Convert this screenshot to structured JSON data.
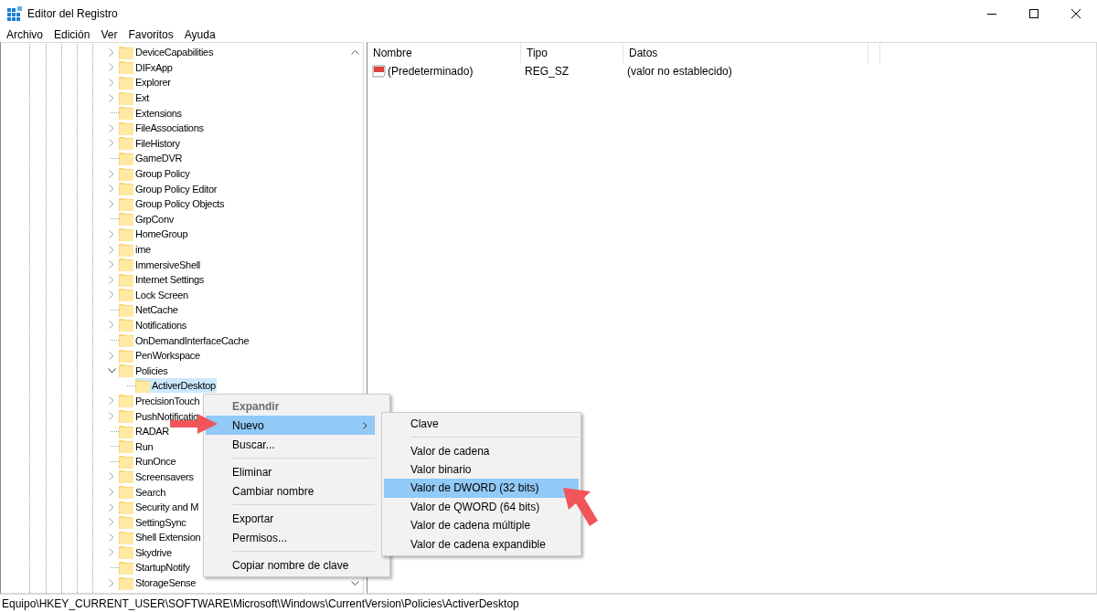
{
  "window": {
    "title": "Editor del Registro"
  },
  "menu_bar": [
    "Archivo",
    "Edición",
    "Ver",
    "Favoritos",
    "Ayuda"
  ],
  "tree": {
    "items": [
      {
        "label": "DeviceCapabilities",
        "has_children": true,
        "expanded": false,
        "selected": false
      },
      {
        "label": "DIFxApp",
        "has_children": true,
        "expanded": false,
        "selected": false
      },
      {
        "label": "Explorer",
        "has_children": true,
        "expanded": false,
        "selected": false
      },
      {
        "label": "Ext",
        "has_children": true,
        "expanded": false,
        "selected": false
      },
      {
        "label": "Extensions",
        "has_children": false,
        "selected": false
      },
      {
        "label": "FileAssociations",
        "has_children": true,
        "expanded": false,
        "selected": false
      },
      {
        "label": "FileHistory",
        "has_children": true,
        "expanded": false,
        "selected": false
      },
      {
        "label": "GameDVR",
        "has_children": false,
        "selected": false
      },
      {
        "label": "Group Policy",
        "has_children": true,
        "expanded": false,
        "selected": false
      },
      {
        "label": "Group Policy Editor",
        "has_children": true,
        "expanded": false,
        "selected": false
      },
      {
        "label": "Group Policy Objects",
        "has_children": true,
        "expanded": false,
        "selected": false
      },
      {
        "label": "GrpConv",
        "has_children": false,
        "selected": false
      },
      {
        "label": "HomeGroup",
        "has_children": true,
        "expanded": false,
        "selected": false
      },
      {
        "label": "ime",
        "has_children": true,
        "expanded": false,
        "selected": false
      },
      {
        "label": "ImmersiveShell",
        "has_children": true,
        "expanded": false,
        "selected": false
      },
      {
        "label": "Internet Settings",
        "has_children": true,
        "expanded": false,
        "selected": false
      },
      {
        "label": "Lock Screen",
        "has_children": true,
        "expanded": false,
        "selected": false
      },
      {
        "label": "NetCache",
        "has_children": false,
        "selected": false
      },
      {
        "label": "Notifications",
        "has_children": true,
        "expanded": false,
        "selected": false
      },
      {
        "label": "OnDemandInterfaceCache",
        "has_children": false,
        "selected": false
      },
      {
        "label": "PenWorkspace",
        "has_children": true,
        "expanded": false,
        "selected": false
      },
      {
        "label": "Policies",
        "has_children": true,
        "expanded": true,
        "selected": false,
        "children": [
          {
            "label": "ActiverDesktop",
            "has_children": false,
            "selected": true
          }
        ]
      },
      {
        "label": "PrecisionTouch",
        "has_children": true,
        "expanded": false,
        "selected": false
      },
      {
        "label": "PushNotificatio",
        "has_children": true,
        "expanded": false,
        "selected": false
      },
      {
        "label": "RADAR",
        "has_children": false,
        "selected": false
      },
      {
        "label": "Run",
        "has_children": false,
        "selected": false
      },
      {
        "label": "RunOnce",
        "has_children": false,
        "selected": false
      },
      {
        "label": "Screensavers",
        "has_children": true,
        "expanded": false,
        "selected": false
      },
      {
        "label": "Search",
        "has_children": true,
        "expanded": false,
        "selected": false
      },
      {
        "label": "Security and M",
        "has_children": true,
        "expanded": false,
        "selected": false
      },
      {
        "label": "SettingSync",
        "has_children": true,
        "expanded": false,
        "selected": false
      },
      {
        "label": "Shell Extension",
        "has_children": true,
        "expanded": false,
        "selected": false
      },
      {
        "label": "Skydrive",
        "has_children": true,
        "expanded": false,
        "selected": false
      },
      {
        "label": "StartupNotify",
        "has_children": false,
        "selected": false
      },
      {
        "label": "StorageSense",
        "has_children": true,
        "expanded": false,
        "selected": false
      }
    ]
  },
  "values": {
    "columns": [
      "Nombre",
      "Tipo",
      "Datos"
    ],
    "rows": [
      {
        "name": "(Predeterminado)",
        "type": "REG_SZ",
        "data": "(valor no establecido)"
      }
    ]
  },
  "context_menu": {
    "items": [
      {
        "kind": "item",
        "label": "Expandir",
        "default": true,
        "disabled": true,
        "selected": false,
        "submenu": false
      },
      {
        "kind": "item",
        "label": "Nuevo",
        "default": false,
        "disabled": false,
        "selected": true,
        "submenu": true
      },
      {
        "kind": "item",
        "label": "Buscar...",
        "default": false,
        "disabled": false,
        "selected": false,
        "submenu": false
      },
      {
        "kind": "separator"
      },
      {
        "kind": "item",
        "label": "Eliminar",
        "default": false,
        "disabled": false,
        "selected": false,
        "submenu": false
      },
      {
        "kind": "item",
        "label": "Cambiar nombre",
        "default": false,
        "disabled": false,
        "selected": false,
        "submenu": false
      },
      {
        "kind": "separator"
      },
      {
        "kind": "item",
        "label": "Exportar",
        "default": false,
        "disabled": false,
        "selected": false,
        "submenu": false
      },
      {
        "kind": "item",
        "label": "Permisos...",
        "default": false,
        "disabled": false,
        "selected": false,
        "submenu": false
      },
      {
        "kind": "separator"
      },
      {
        "kind": "item",
        "label": "Copiar nombre de clave",
        "default": false,
        "disabled": false,
        "selected": false,
        "submenu": false
      }
    ]
  },
  "submenu": {
    "items": [
      {
        "kind": "item",
        "label": "Clave",
        "selected": false
      },
      {
        "kind": "separator"
      },
      {
        "kind": "item",
        "label": "Valor de cadena",
        "selected": false
      },
      {
        "kind": "item",
        "label": "Valor binario",
        "selected": false
      },
      {
        "kind": "item",
        "label": "Valor de DWORD (32 bits)",
        "selected": true
      },
      {
        "kind": "item",
        "label": "Valor de QWORD (64 bits)",
        "selected": false
      },
      {
        "kind": "item",
        "label": "Valor de cadena múltiple",
        "selected": false
      },
      {
        "kind": "item",
        "label": "Valor de cadena expandible",
        "selected": false
      }
    ]
  },
  "status_bar": "Equipo\\HKEY_CURRENT_USER\\SOFTWARE\\Microsoft\\Windows\\CurrentVersion\\Policies\\ActiverDesktop"
}
